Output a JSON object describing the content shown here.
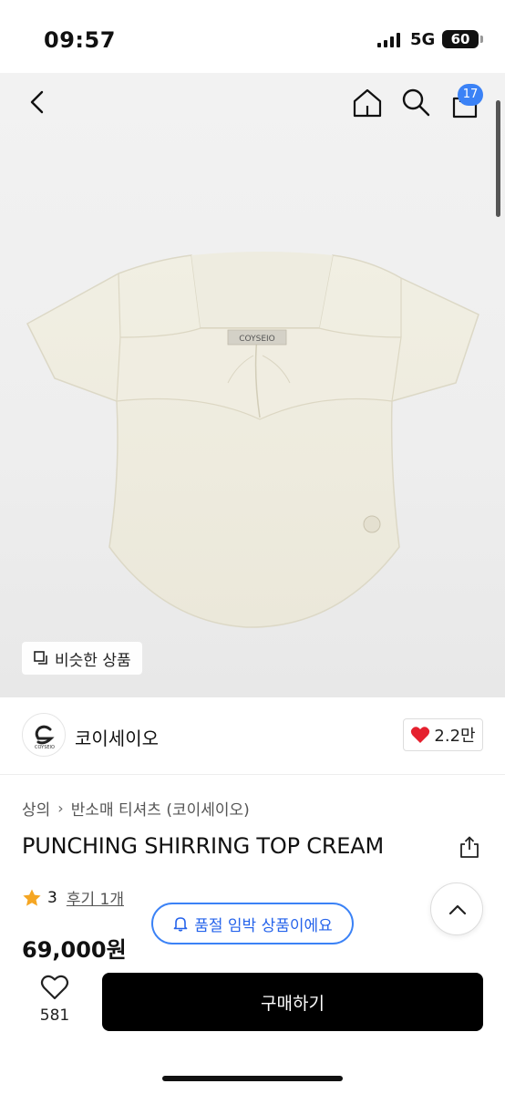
{
  "status": {
    "time": "09:57",
    "network": "5G",
    "battery": "60"
  },
  "nav": {
    "back_icon": "chevron-left-icon",
    "home_icon": "home-icon",
    "search_icon": "search-icon",
    "cart_icon": "shopping-bag-icon",
    "cart_count": "17"
  },
  "hero": {
    "product_image": "cream short-sleeve shirring top",
    "label_text": "COYSEIO",
    "similar_label": "비슷한 상품"
  },
  "brand": {
    "name": "코이세이오",
    "logo_text": "COYSEIO",
    "likes": "2.2만"
  },
  "product": {
    "breadcrumb": [
      "상의",
      "반소매 티셔츠 (코이세이오)"
    ],
    "title": "PUNCHING SHIRRING TOP CREAM",
    "rating": "3",
    "review_link": "후기 1개",
    "price": "69,000원",
    "stock_notice": "품절 임박 상품이에요"
  },
  "bottom": {
    "wish_count": "581",
    "buy_label": "구매하기"
  },
  "colors": {
    "accent_blue": "#3b82f6",
    "heart_red": "#e5202e",
    "star_orange": "#f5a623",
    "buy_black": "#000000"
  }
}
